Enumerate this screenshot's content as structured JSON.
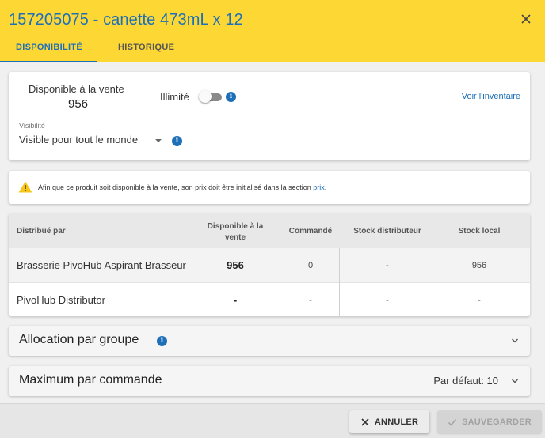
{
  "header": {
    "title": "157205075 - canette 473mL x 12",
    "tabs": [
      {
        "label": "DISPONIBILITÉ",
        "active": true
      },
      {
        "label": "HISTORIQUE",
        "active": false
      }
    ]
  },
  "availability": {
    "label": "Disponible à la vente",
    "value": "956",
    "unlimited_label": "Illimité",
    "unlimited_enabled": false,
    "inventory_link": "Voir l'inventaire",
    "visibility_label": "Visibilité",
    "visibility_value": "Visible pour tout le monde"
  },
  "warning": {
    "text": "Afin que ce produit soit disponible à la vente, son prix doit être initialisé dans la section ",
    "link": "prix",
    "end": "."
  },
  "table": {
    "headers": {
      "distributor": "Distribué par",
      "available": "Disponible à la vente",
      "ordered": "Commandé",
      "distributor_stock": "Stock distributeur",
      "local_stock": "Stock local"
    },
    "rows": [
      {
        "distributor": "Brasserie PivoHub Aspirant Brasseur",
        "available": "956",
        "ordered": "0",
        "distributor_stock": "-",
        "local_stock": "956"
      },
      {
        "distributor": "PivoHub Distributor",
        "available": "-",
        "ordered": "-",
        "distributor_stock": "-",
        "local_stock": "-"
      }
    ]
  },
  "sections": {
    "allocation": {
      "title": "Allocation par groupe"
    },
    "max_order": {
      "title": "Maximum par commande",
      "value": "Par défaut: 10"
    }
  },
  "footer": {
    "cancel": "ANNULER",
    "save": "SAUVEGARDER",
    "save_disabled": true
  },
  "colors": {
    "header_bg": "#fdd835",
    "accent": "#1d6fb8",
    "warning_icon": "#f5c518"
  },
  "icons": [
    "close-icon",
    "info-icon",
    "warning-icon",
    "chevron-down-icon",
    "check-icon"
  ]
}
